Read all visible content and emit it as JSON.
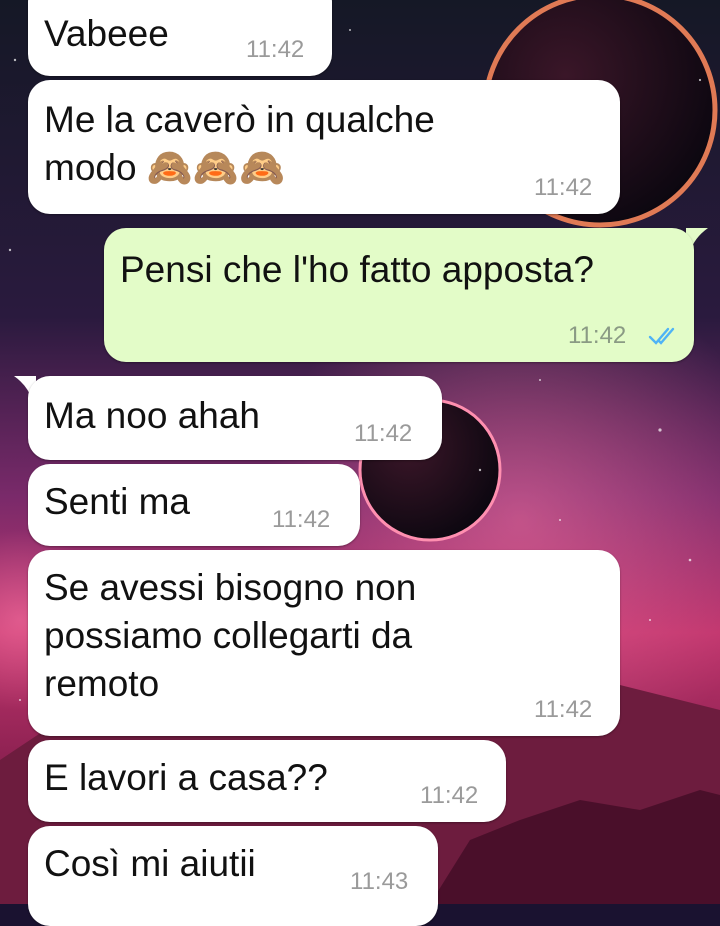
{
  "chat": {
    "messages": [
      {
        "direction": "in",
        "text": "Vabeee",
        "time": "11:42"
      },
      {
        "direction": "in",
        "text": "Me la caverò in qualche\nmodo 🙈🙈🙈",
        "time": "11:42"
      },
      {
        "direction": "out",
        "text": "Pensi che l'ho fatto apposta?",
        "time": "11:42",
        "status_icon": "double-check-read-icon",
        "status_color": "#4fb3f6"
      },
      {
        "direction": "in",
        "text": "Ma noo ahah",
        "time": "11:42"
      },
      {
        "direction": "in",
        "text": "Senti ma",
        "time": "11:42"
      },
      {
        "direction": "in",
        "text": "Se avessi bisogno non\npossiamo collegarti da\nremoto",
        "time": "11:42"
      },
      {
        "direction": "in",
        "text": "E lavori a casa??",
        "time": "11:42"
      },
      {
        "direction": "in",
        "text": "Così mi aiutii",
        "time": "11:43"
      }
    ]
  },
  "theme": {
    "incoming_bubble": "#ffffff",
    "outgoing_bubble": "#e3fcc8",
    "timestamp": "#9a9a9a"
  }
}
